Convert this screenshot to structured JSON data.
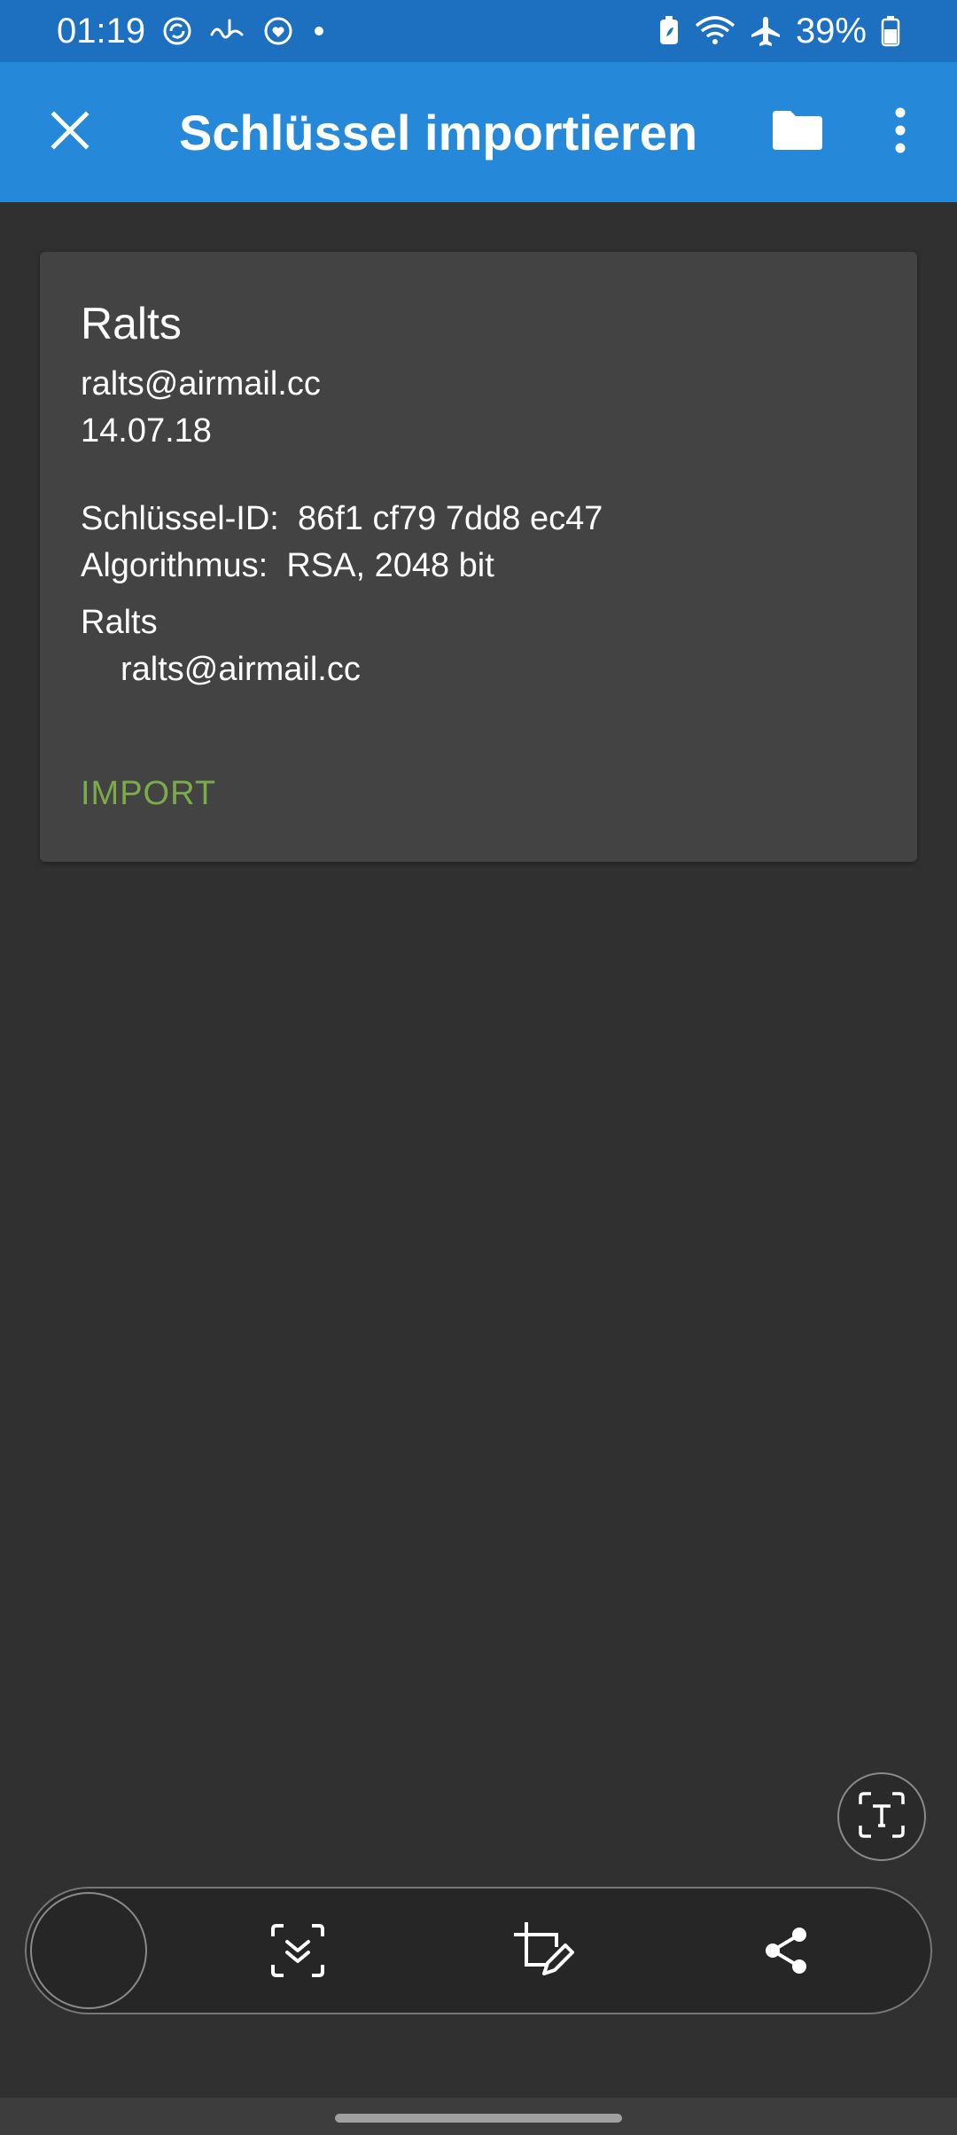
{
  "status_bar": {
    "time": "01:19",
    "battery_percent": "39%",
    "left_icons": [
      "sync-icon",
      "mail-icon",
      "heart-icon",
      "dot-icon"
    ],
    "right_icons": [
      "battery-saver-icon",
      "wifi-icon",
      "airplane-icon",
      "battery-icon"
    ]
  },
  "app_bar": {
    "title": "Schlüssel importieren",
    "close_icon": "close-icon",
    "folder_icon": "folder-icon",
    "more_icon": "more-vert-icon"
  },
  "key_card": {
    "name": "Ralts",
    "email": "ralts@airmail.cc",
    "date": "14.07.18",
    "key_id_label": "Schlüssel-ID:",
    "key_id_value": "86f1 cf79 7dd8 ec47",
    "algorithm_label": "Algorithmus:",
    "algorithm_value": "RSA, 2048 bit",
    "user_ids": [
      {
        "name": "Ralts",
        "email": "ralts@airmail.cc"
      }
    ],
    "import_label": "IMPORT"
  },
  "toolbar": {
    "icons": [
      "scroll-capture-icon",
      "crop-edit-icon",
      "share-icon"
    ],
    "text_extract_icon": "text-extract-icon"
  },
  "colors": {
    "status_bar": "#1d6fc0",
    "app_bar": "#2588d8",
    "background": "#303030",
    "card": "#434343",
    "import_accent": "#7cac4a"
  }
}
